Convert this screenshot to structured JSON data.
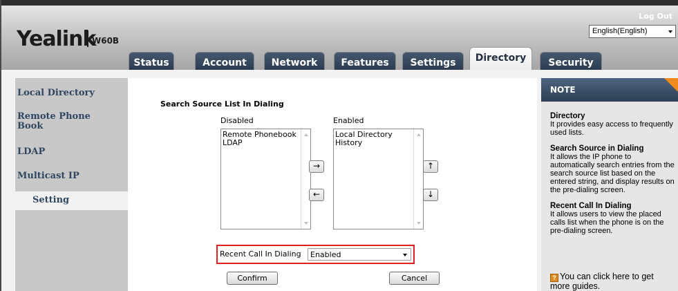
{
  "header": {
    "brand": "Yealink",
    "model": "W60B",
    "logout_label": "Log Out",
    "language": "English(English)"
  },
  "tabs": [
    {
      "label": "Status"
    },
    {
      "label": "Account"
    },
    {
      "label": "Network"
    },
    {
      "label": "Features"
    },
    {
      "label": "Settings"
    },
    {
      "label": "Directory",
      "active": true
    },
    {
      "label": "Security"
    }
  ],
  "sidebar": {
    "items": [
      {
        "label": "Local Directory"
      },
      {
        "label": "Remote Phone Book"
      },
      {
        "label": "LDAP"
      },
      {
        "label": "Multicast IP"
      },
      {
        "label": "Setting",
        "active": true
      }
    ]
  },
  "main": {
    "section_title": "Search Source List In Dialing",
    "disabled_label": "Disabled",
    "enabled_label": "Enabled",
    "disabled_items": [
      "Remote Phonebook",
      "LDAP"
    ],
    "enabled_items": [
      "Local Directory",
      "History"
    ],
    "move_right": "→",
    "move_left": "←",
    "move_up": "↑",
    "move_down": "↓",
    "recent_call_label": "Recent Call In Dialing",
    "recent_call_value": "Enabled",
    "confirm_label": "Confirm",
    "cancel_label": "Cancel"
  },
  "note": {
    "title": "NOTE",
    "sections": [
      {
        "heading": "Directory",
        "text": "It provides easy access to frequently used lists."
      },
      {
        "heading": "Search Source in Dialing",
        "text": "It allows the IP phone to automatically search entries from the search source list based on the entered string, and display results on the pre-dialing screen."
      },
      {
        "heading": "Recent Call In Dialing",
        "text": "It allows users to view the placed calls list when the phone is on the pre-dialing screen."
      }
    ],
    "guide_text": "You can click here to get more guides.",
    "guide_icon": "?"
  },
  "colors": {
    "tab_bg": "#2f4258",
    "sidebar_text": "#2f4660",
    "highlight_border": "#e02020",
    "note_corner": "#f08a1e"
  }
}
